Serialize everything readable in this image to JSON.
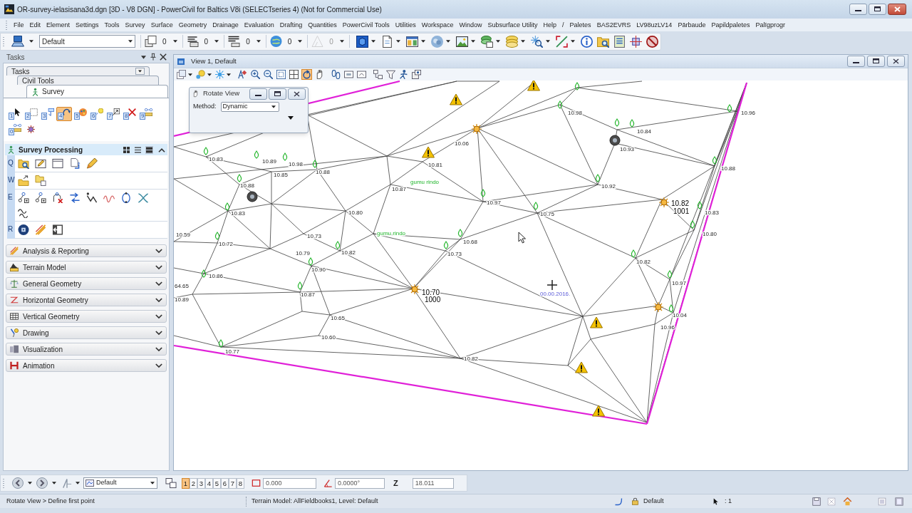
{
  "window": {
    "title": "OR-survey-ielasisana3d.dgn [3D - V8 DGN] - PowerCivil for Baltics V8i (SELECTseries 4) (Not for Commercial Use)"
  },
  "menu": [
    "File",
    "Edit",
    "Element",
    "Settings",
    "Tools",
    "Survey",
    "Surface",
    "Geometry",
    "Drainage",
    "Evaluation",
    "Drafting",
    "Quantities",
    "PowerCivil Tools",
    "Utilities",
    "Workspace",
    "Window",
    "Subsurface Utility",
    "Help",
    "/",
    "Paletes",
    "BAS2EVRS",
    "LV98uzLV14",
    "Pārbaude",
    "Papildpaletes",
    "Palīgprogr"
  ],
  "toolbar": {
    "active_model": "Default",
    "counters": [
      {
        "value": "0",
        "disabled": false
      },
      {
        "value": "0",
        "disabled": false
      },
      {
        "value": "0",
        "disabled": false
      },
      {
        "value": "0",
        "disabled": false
      },
      {
        "value": "0",
        "disabled": true
      }
    ]
  },
  "tasks_panel": {
    "title": "Tasks",
    "tabs": [
      {
        "label": "Tasks",
        "selected": false
      },
      {
        "label": "Civil Tools",
        "selected": false
      },
      {
        "label": "Survey",
        "selected": true
      }
    ],
    "tools": [
      {
        "key": "1",
        "selected": false
      },
      {
        "key": "2",
        "selected": false
      },
      {
        "key": "3",
        "selected": false
      },
      {
        "key": "4",
        "selected": true
      },
      {
        "key": "5",
        "selected": false
      },
      {
        "key": "6",
        "selected": false
      },
      {
        "key": "7",
        "selected": false
      },
      {
        "key": "8",
        "selected": false
      },
      {
        "key": "9",
        "selected": false
      },
      {
        "key": "0",
        "selected": false
      },
      {
        "selected": false
      }
    ],
    "sections": [
      {
        "title": "Survey Processing",
        "expanded": true,
        "view_modes": [
          {
            "selected": false
          },
          {
            "selected": false
          },
          {
            "selected": true
          }
        ],
        "groups": [
          {
            "letter": "Q"
          },
          {
            "letter": "W"
          },
          {
            "letter": "E"
          },
          {
            "letter": "R"
          }
        ]
      },
      {
        "title": "Analysis & Reporting",
        "expanded": false
      },
      {
        "title": "Terrain Model",
        "expanded": false
      },
      {
        "title": "General Geometry",
        "expanded": false
      },
      {
        "title": "Horizontal Geometry",
        "expanded": false
      },
      {
        "title": "Vertical Geometry",
        "expanded": false
      },
      {
        "title": "Drawing",
        "expanded": false
      },
      {
        "title": "Visualization",
        "expanded": false
      },
      {
        "title": "Animation",
        "expanded": false
      }
    ]
  },
  "view": {
    "title": "View 1, Default",
    "tools": [
      {
        "selected": false
      },
      {
        "selected": false
      },
      {
        "selected": false
      },
      {
        "selected": false
      },
      {
        "selected": false
      },
      {
        "selected": false
      },
      {
        "selected": false
      },
      {
        "selected": false
      },
      {
        "selected": true
      },
      {
        "selected": false
      },
      {
        "selected": false
      },
      {
        "selected": false
      },
      {
        "selected": false
      },
      {
        "selected": false
      },
      {
        "selected": false
      },
      {
        "selected": false
      },
      {
        "selected": false
      }
    ]
  },
  "rotate_dialog": {
    "title": "Rotate View",
    "method_label": "Method:",
    "method": "Dynamic"
  },
  "canvas": {
    "labels": [
      {
        "text": "10.96",
        "kind": "elevation"
      },
      {
        "text": "10.98",
        "kind": "elevation"
      },
      {
        "text": "10.84",
        "kind": "elevation"
      },
      {
        "text": "10.93",
        "kind": "elevation"
      },
      {
        "text": "10.06",
        "kind": "elevation"
      },
      {
        "text": "10.81",
        "kind": "elevation"
      },
      {
        "text": "10.88",
        "kind": "elevation"
      },
      {
        "text": "10.92",
        "kind": "elevation"
      },
      {
        "text": "10.82",
        "kind": "point"
      },
      {
        "text": "1001",
        "kind": "point"
      },
      {
        "text": "10.83",
        "kind": "elevation"
      },
      {
        "text": "10.80",
        "kind": "elevation"
      },
      {
        "text": "10.97",
        "kind": "elevation"
      },
      {
        "text": "10.75",
        "kind": "elevation"
      },
      {
        "text": "10.68",
        "kind": "elevation"
      },
      {
        "text": "10.73",
        "kind": "elevation"
      },
      {
        "text": "10.82",
        "kind": "elevation"
      },
      {
        "text": "10.70",
        "kind": "point"
      },
      {
        "text": "1000",
        "kind": "point"
      },
      {
        "text": "10.83",
        "kind": "elevation"
      },
      {
        "text": "10.89",
        "kind": "elevation"
      },
      {
        "text": "10.98",
        "kind": "elevation"
      },
      {
        "text": "10.85",
        "kind": "elevation"
      },
      {
        "text": "10.88",
        "kind": "elevation"
      },
      {
        "text": "10.88",
        "kind": "elevation"
      },
      {
        "text": "10.83",
        "kind": "elevation"
      },
      {
        "text": "10.80",
        "kind": "elevation"
      },
      {
        "text": "10.73",
        "kind": "elevation"
      },
      {
        "text": "10.72",
        "kind": "elevation"
      },
      {
        "text": "10.79",
        "kind": "elevation"
      },
      {
        "text": "10.82",
        "kind": "elevation"
      },
      {
        "text": "10.90",
        "kind": "elevation"
      },
      {
        "text": "10.86",
        "kind": "elevation"
      },
      {
        "text": "10.87",
        "kind": "elevation"
      },
      {
        "text": "10.65",
        "kind": "elevation"
      },
      {
        "text": "10.60",
        "kind": "elevation"
      },
      {
        "text": "10.82",
        "kind": "elevation"
      },
      {
        "text": "10.59",
        "kind": "elevation"
      },
      {
        "text": "64.65",
        "kind": "elevation"
      },
      {
        "text": "10.89",
        "kind": "elevation"
      },
      {
        "text": "10.77",
        "kind": "elevation"
      },
      {
        "text": "10.97",
        "kind": "elevation"
      },
      {
        "text": "10.04",
        "kind": "elevation"
      },
      {
        "text": "10.96",
        "kind": "elevation"
      },
      {
        "text": "10.87",
        "kind": "elevation"
      },
      {
        "text": "gumu rindo",
        "kind": "feature"
      },
      {
        "text": "gumu rindo",
        "kind": "feature"
      },
      {
        "text": "00.00.2016.",
        "kind": "note"
      }
    ]
  },
  "view_bar": {
    "model": "Default",
    "views": [
      {
        "label": "1",
        "selected": true
      },
      {
        "label": "2",
        "selected": false
      },
      {
        "label": "3",
        "selected": false
      },
      {
        "label": "4",
        "selected": false
      },
      {
        "label": "5",
        "selected": false
      },
      {
        "label": "6",
        "selected": false
      },
      {
        "label": "7",
        "selected": false
      },
      {
        "label": "8",
        "selected": false
      }
    ],
    "fields": [
      {
        "value": "0.000"
      },
      {
        "value": "0.0000°"
      }
    ],
    "z_label": "Z",
    "z_value": "18.011"
  },
  "status_bar": {
    "prompt": "Rotate View > Define first point",
    "message": "Terrain Model: AllFieldbooks1, Level: Default",
    "level": "Default",
    "selection": ": 1"
  }
}
